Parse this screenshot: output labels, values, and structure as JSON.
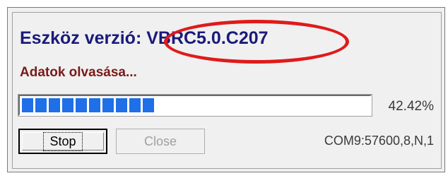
{
  "dialog": {
    "title": "Eszköz verzió: VBRC5.0.C207",
    "status_message": "Adatok olvasása...",
    "progress": {
      "percent_label": "42.42%",
      "value": 0.4242
    },
    "buttons": {
      "stop_label": "Stop",
      "close_label": "Close"
    },
    "port_info": "COM9:57600,8,N,1"
  },
  "colors": {
    "title": "#1a1a7a",
    "status_message": "#7a1a1a",
    "progress_fill": "#1e6fe8",
    "annotation": "#e01a1a"
  }
}
